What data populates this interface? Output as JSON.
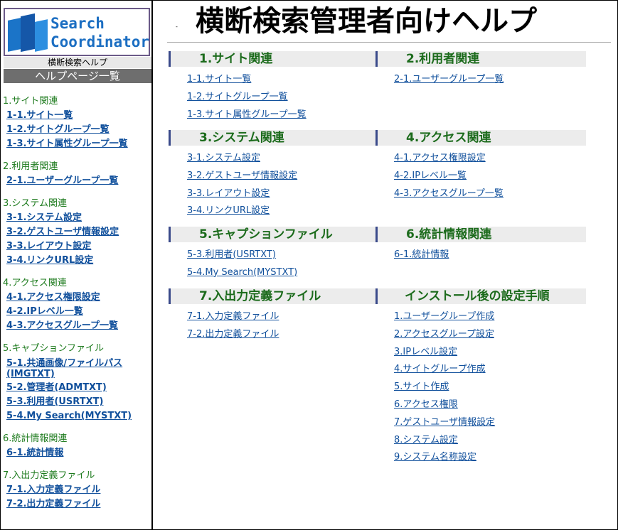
{
  "sidebar": {
    "logo": {
      "line1": "Search",
      "line2": "Coordinator"
    },
    "subtitle": "横断検索ヘルプ",
    "heading": "ヘルプページ一覧",
    "groups": [
      {
        "category": "1.サイト関連",
        "links": [
          "1-1.サイト一覧",
          "1-2.サイトグループ一覧",
          "1-3.サイト属性グループ一覧"
        ]
      },
      {
        "category": "2.利用者関連",
        "links": [
          "2-1.ユーザーグループ一覧"
        ]
      },
      {
        "category": "3.システム関連",
        "links": [
          "3-1.システム設定",
          "3-2.ゲストユーザ情報設定",
          "3-3.レイアウト設定",
          "3-4.リンクURL設定"
        ]
      },
      {
        "category": "4.アクセス関連",
        "links": [
          "4-1.アクセス権限設定",
          "4-2.IPレベル一覧",
          "4-3.アクセスグループ一覧"
        ]
      },
      {
        "category": "5.キャプションファイル",
        "links": [
          "5-1.共通画像/ファイルパス(IMGTXT)",
          "5-2.管理者(ADMTXT)",
          "5-3.利用者(USRTXT)",
          "5-4.My Search(MYSTXT)"
        ]
      },
      {
        "category": "6.統計情報関連",
        "links": [
          "6-1.統計情報"
        ]
      },
      {
        "category": "7.入出力定義ファイル",
        "links": [
          "7-1.入力定義ファイル",
          "7-2.出力定義ファイル"
        ]
      }
    ]
  },
  "main": {
    "marker": "-",
    "title": "横断検索管理者向けヘルプ",
    "sections": [
      {
        "num": "1.",
        "title": "サイト関連",
        "links": [
          "1-1.サイト一覧",
          "1-2.サイトグループ一覧",
          "1-3.サイト属性グループ一覧"
        ]
      },
      {
        "num": "2.",
        "title": "利用者関連",
        "links": [
          "2-1.ユーザーグループ一覧"
        ]
      },
      {
        "num": "3.",
        "title": "システム関連",
        "links": [
          "3-1.システム設定",
          "3-2.ゲストユーザ情報設定",
          "3-3.レイアウト設定",
          "3-4.リンクURL設定"
        ]
      },
      {
        "num": "4.",
        "title": "アクセス関連",
        "links": [
          "4-1.アクセス権限設定",
          "4-2.IPレベル一覧",
          "4-3.アクセスグループ一覧"
        ]
      },
      {
        "num": "5.",
        "title": "キャプションファイル",
        "links": [
          "5-3.利用者(USRTXT)",
          "5-4.My Search(MYSTXT)"
        ]
      },
      {
        "num": "6.",
        "title": "統計情報関連",
        "links": [
          "6-1.統計情報"
        ]
      },
      {
        "num": "7.",
        "title": "入出力定義ファイル",
        "links": [
          "7-1.入力定義ファイル",
          "7-2.出力定義ファイル"
        ]
      },
      {
        "num": "",
        "title": "インストール後の設定手順",
        "links": [
          "1.ユーザーグループ作成",
          "2.アクセスグループ設定",
          "3.IPレベル設定",
          "4.サイトグループ作成",
          "5.サイト作成",
          "6.アクセス権限",
          "7.ゲストユーザ情報設定",
          "8.システム設定",
          "9.システム名称設定"
        ]
      }
    ]
  },
  "colors": {
    "category": "#1e7b1e",
    "link": "#11509c",
    "heading_bg": "#6e6e6e",
    "section_bg": "#ececec",
    "logo_text": "#1b6ec2"
  }
}
